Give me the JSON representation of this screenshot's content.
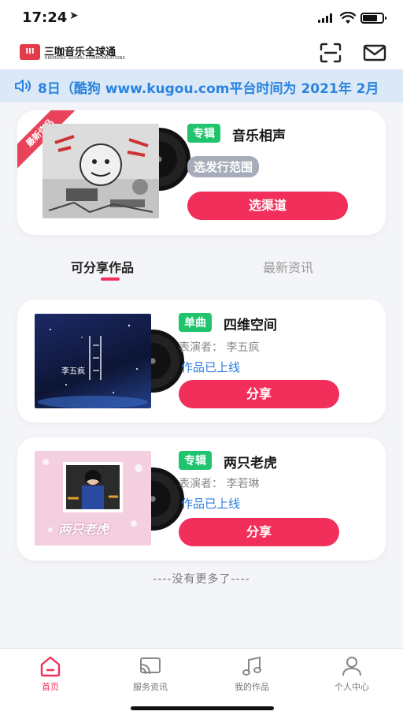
{
  "status_bar": {
    "time": "17:24",
    "location_glyph": "➤"
  },
  "header": {
    "logo_mark": "III",
    "logo_text": "三咖音乐全球通",
    "logo_subtext": "KKKMUSIC GLOBAL COMMUNICATIONS",
    "icons": [
      "scan-icon",
      "mail-icon"
    ]
  },
  "notice": {
    "text": "8日（酷狗 www.kugou.com平台时间为 2021年 2月"
  },
  "featured": {
    "ribbon": "最新作品",
    "tag": "专辑",
    "title": "音乐相声",
    "range_label": "选发行范围",
    "button": "选渠道"
  },
  "tabs": [
    {
      "label": "可分享作品",
      "active": true
    },
    {
      "label": "最新资讯",
      "active": false
    }
  ],
  "works": [
    {
      "tag": "单曲",
      "title": "四维空间",
      "performer": "表演者：  李五疯",
      "status": "作品已上线",
      "button": "分享",
      "cover_text": "李五疯"
    },
    {
      "tag": "专辑",
      "title": "两只老虎",
      "performer": "表演者：  李若琳",
      "status": "作品已上线",
      "button": "分享",
      "cover_text": "两只老虎"
    }
  ],
  "no_more": "----没有更多了----",
  "bottom_nav": [
    {
      "label": "首页",
      "icon": "home-icon",
      "active": true
    },
    {
      "label": "服务资讯",
      "icon": "cast-icon",
      "active": false
    },
    {
      "label": "我的作品",
      "icon": "music-note-icon",
      "active": false
    },
    {
      "label": "个人中心",
      "icon": "user-icon",
      "active": false
    }
  ],
  "colors": {
    "accent": "#f22f5a",
    "tag_green": "#1fc46d",
    "link_blue": "#2a7de1",
    "notice_bg": "#dbe9f7"
  }
}
